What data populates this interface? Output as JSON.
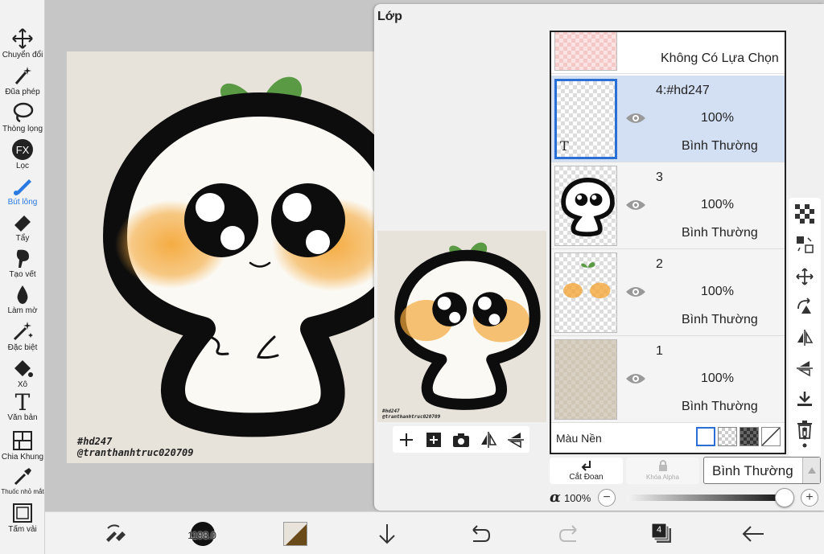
{
  "tools": [
    {
      "label": "Chuyển đổi",
      "icon": "move-arrows-icon"
    },
    {
      "label": "Đũa phép",
      "icon": "magic-wand-icon"
    },
    {
      "label": "Thòng lọng",
      "icon": "lasso-icon"
    },
    {
      "label": "Lọc",
      "icon": "fx-filter-icon"
    },
    {
      "label": "Bút lông",
      "icon": "brush-icon",
      "active": true
    },
    {
      "label": "Tẩy",
      "icon": "eraser-icon"
    },
    {
      "label": "Tạo vết",
      "icon": "smudge-icon"
    },
    {
      "label": "Làm mờ",
      "icon": "blur-drop-icon"
    },
    {
      "label": "Đặc biệt",
      "icon": "sparkle-icon"
    },
    {
      "label": "Xô",
      "icon": "bucket-icon"
    },
    {
      "label": "Văn bản",
      "icon": "text-t-icon"
    },
    {
      "label": "Chia Khung",
      "icon": "frame-divide-icon"
    },
    {
      "label": "Thuốc nhỏ mắt",
      "icon": "eyedropper-icon"
    },
    {
      "label": "Tấm vải",
      "icon": "canvas-icon"
    }
  ],
  "canvas": {
    "tag_line1": "#hd247",
    "tag_line2": "@tranthanhtruc020709"
  },
  "layer_panel": {
    "title": "Lớp",
    "selection_label": "Không Có Lựa Chọn",
    "layers": [
      {
        "name": "4:#hd247",
        "opacity": "100%",
        "blend": "Bình Thường",
        "selected": true
      },
      {
        "name": "3",
        "opacity": "100%",
        "blend": "Bình Thường",
        "selected": false
      },
      {
        "name": "2",
        "opacity": "100%",
        "blend": "Bình Thường",
        "selected": false
      },
      {
        "name": "1",
        "opacity": "100%",
        "blend": "Bình Thường",
        "selected": false
      }
    ],
    "background_label": "Màu Nền",
    "clipping_label": "Cắt Đoan",
    "alpha_lock_label": "Khóa Alpha",
    "blend_mode": "Bình Thường",
    "alpha_symbol": "α",
    "alpha_value": "100%",
    "alpha_level": 1.0,
    "thumb_text_glyph": "T"
  },
  "bottom": {
    "brush_size": "1198.0",
    "layer_count": "4"
  },
  "colors": {
    "accent": "#2a7ae2",
    "selected_layer": "#d3e0f3",
    "paper": "#e8e3da",
    "sprout": "#5a9a45",
    "blush": "#f4a83a"
  }
}
